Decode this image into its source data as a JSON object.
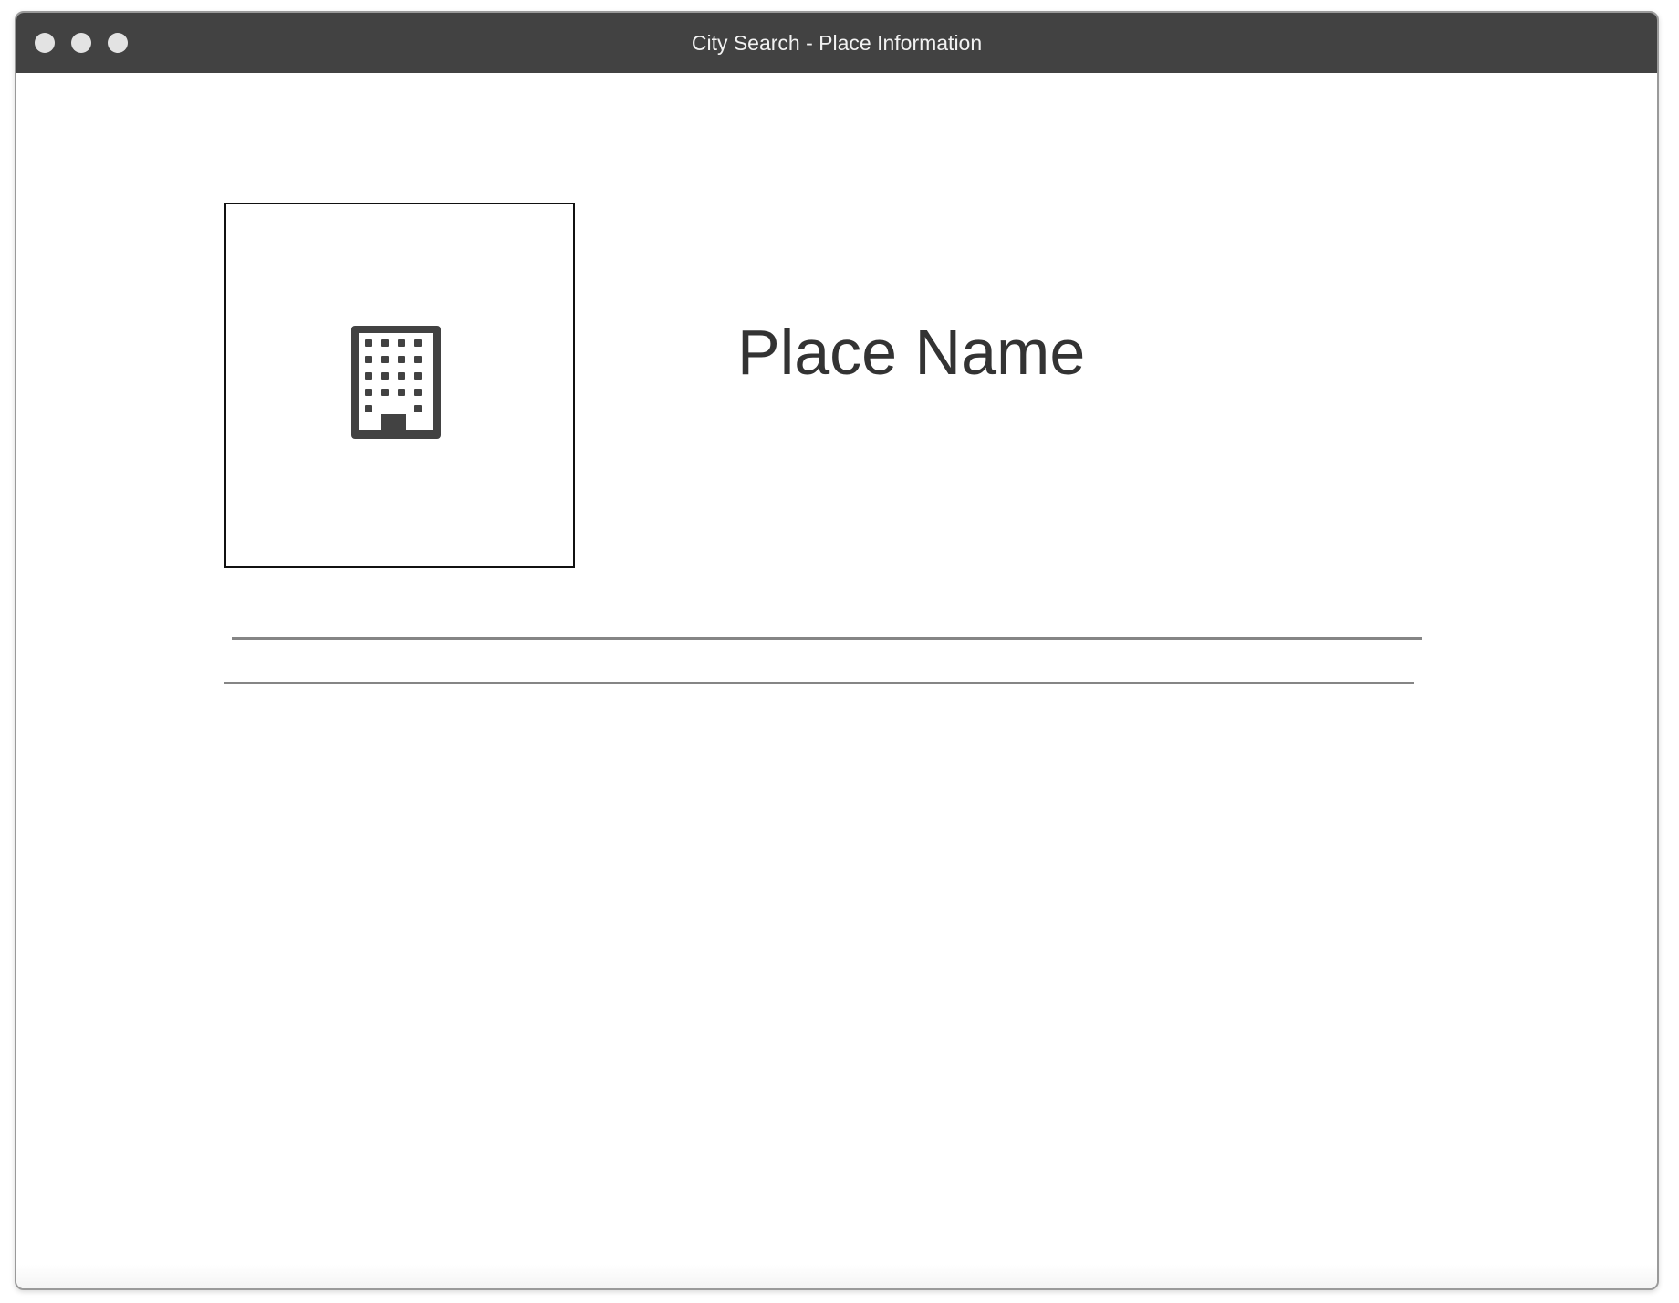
{
  "window": {
    "title": "City Search - Place Information",
    "titlebar_color": "#424242",
    "controls": [
      "close",
      "minimize",
      "zoom"
    ]
  },
  "place": {
    "name": "Place Name",
    "image_icon": "building-icon"
  },
  "colors": {
    "text": "#333333",
    "icon": "#424242",
    "divider": "#858585"
  }
}
